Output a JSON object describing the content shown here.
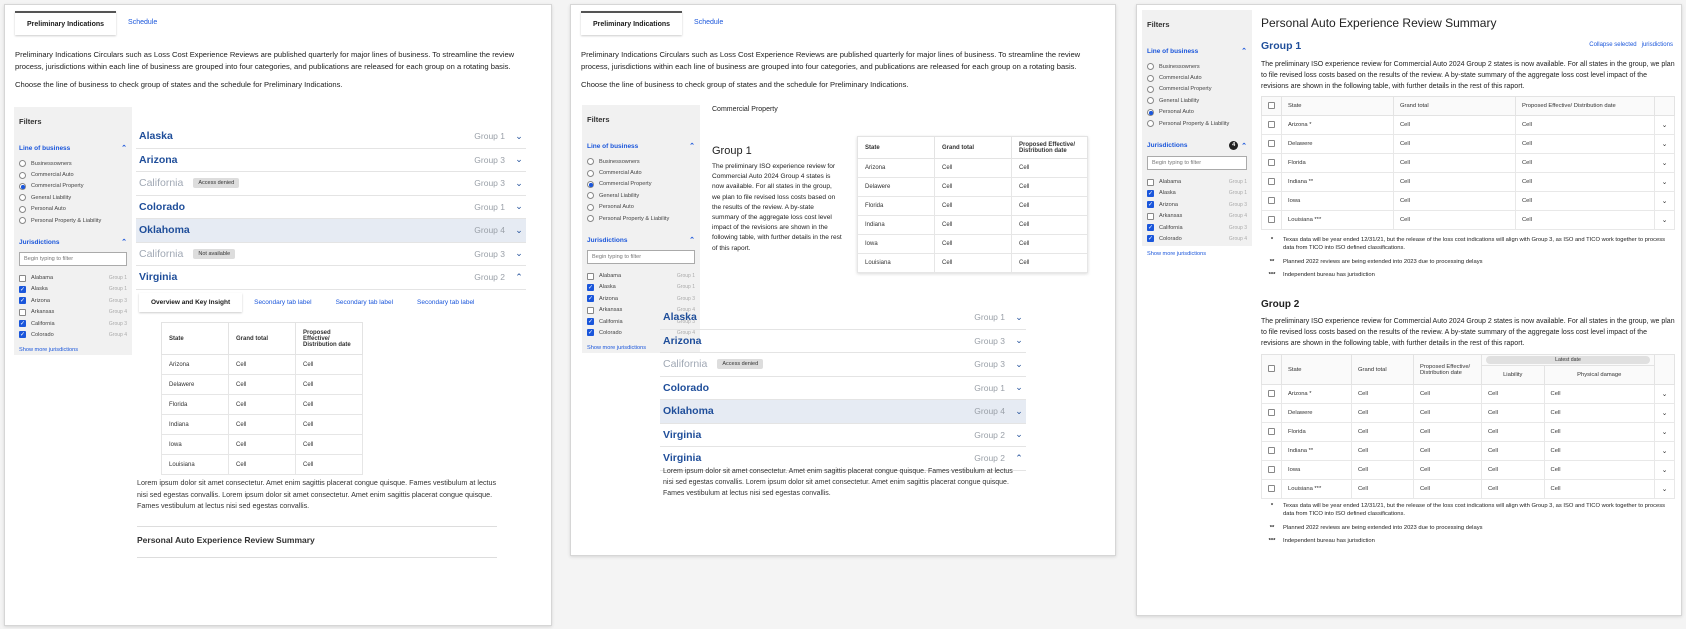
{
  "tabs": [
    "Preliminary Indications",
    "Schedule"
  ],
  "intro": {
    "p1": "Preliminary Indications Circulars such as Loss Cost Experience Reviews are published quarterly for major lines of business. To streamline the review process, jurisdictions within each line of business are grouped into four categories, and publications are released for each group on a rotating basis.",
    "p2": "Choose the line of business to check group of states and the schedule for Preliminary Indications."
  },
  "filters": {
    "title": "Filters",
    "lob_label": "Line of business",
    "lob_items": [
      "Businessowners",
      "Commercial Auto",
      "Commercial Property",
      "General Liability",
      "Personal Auto",
      "Personal Property & Liability"
    ],
    "jur_label": "Jurisdictions",
    "jur_placeholder": "Begin typing to filter",
    "jur_count": "4",
    "jur_items": [
      {
        "name": "Alabama",
        "group": "Group 1"
      },
      {
        "name": "Alaska",
        "group": "Group 1"
      },
      {
        "name": "Arizona",
        "group": "Group 3"
      },
      {
        "name": "Arkansas",
        "group": "Group 4"
      },
      {
        "name": "California",
        "group": "Group 3"
      },
      {
        "name": "Colorado",
        "group": "Group 4"
      }
    ],
    "show_more": "Show more jurisdictions"
  },
  "states": [
    {
      "name": "Alaska",
      "group": "Group 1",
      "badge": ""
    },
    {
      "name": "Arizona",
      "group": "Group 3",
      "badge": ""
    },
    {
      "name": "California",
      "group": "Group 3",
      "badge": "Access denied"
    },
    {
      "name": "Colorado",
      "group": "Group 1",
      "badge": ""
    },
    {
      "name": "Oklahoma",
      "group": "Group 4",
      "badge": ""
    },
    {
      "name": "California",
      "group": "Group 3",
      "badge": "Not available"
    },
    {
      "name": "Virginia",
      "group": "Group 2",
      "badge": ""
    }
  ],
  "subtabs": [
    "Overview and Key Insight",
    "Secondary tab label",
    "Secondary tab label",
    "Secondary tab label"
  ],
  "table": {
    "headers": [
      "State",
      "Grand total",
      "Proposed Effective/ Distribution date"
    ],
    "rows": [
      [
        "Arizona",
        "Cell",
        "Cell"
      ],
      [
        "Delawere",
        "Cell",
        "Cell"
      ],
      [
        "Florida",
        "Cell",
        "Cell"
      ],
      [
        "Indiana",
        "Cell",
        "Cell"
      ],
      [
        "Iowa",
        "Cell",
        "Cell"
      ],
      [
        "Louisiana",
        "Cell",
        "Cell"
      ]
    ]
  },
  "lorem": "Lorem ipsum dolor sit amet consectetur. Amet enim sagittis placerat congue quisque. Fames vestibulum at lectus nisi sed egestas convallis. Lorem ipsum dolor sit amet consectetur. Amet enim sagittis placerat congue quisque. Fames vestibulum at lectus nisi sed egestas convallis.",
  "summary_label": "Personal Auto Experience Review Summary",
  "p2": {
    "lob_caption": "Commercial Property",
    "group_title": "Group 1",
    "group_desc": "The preliminary ISO experience review for Commercial Auto 2024 Group 4 states is now available. For all states in the group, we plan to file revised loss costs based on the results of the review. A by-state summary of the aggregate loss cost level impact of the revisions are shown in the following table, with further details in the rest of this raport.",
    "states": [
      {
        "name": "Alaska",
        "group": "Group 1",
        "badge": ""
      },
      {
        "name": "Arizona",
        "group": "Group 3",
        "badge": ""
      },
      {
        "name": "California",
        "group": "Group 3",
        "badge": "Access denied"
      },
      {
        "name": "Colorado",
        "group": "Group 1",
        "badge": ""
      },
      {
        "name": "Oklahoma",
        "group": "Group 4",
        "badge": ""
      },
      {
        "name": "Virginia",
        "group": "Group 2",
        "badge": ""
      },
      {
        "name": "Virginia",
        "group": "Group 2",
        "badge": ""
      }
    ]
  },
  "p3": {
    "title": "Personal Auto Experience Review Summary",
    "group1": "Group 1",
    "group2": "Group 2",
    "collapse": "Collapse selected",
    "jurisdictions_link": "jurisdictions",
    "desc": "The preliminary ISO experience review for Commercial Auto 2024 Group 2 states is now available. For all states in the group, we plan to file revised loss costs based on the results of the review. A by-state summary of the aggregate loss cost level impact of the revisions are shown in the following table, with further details in the rest of this raport.",
    "t1_headers": [
      "State",
      "Grand total",
      "Proposed Effective/ Distribution date"
    ],
    "t2_headers": [
      "State",
      "Grand total",
      "Proposed Effective/ Distribution date",
      "Latest date",
      "Liability",
      "Physical damage"
    ],
    "rows": [
      "Arizona *",
      "Delawere",
      "Florida",
      "Indiana **",
      "Iowa",
      "Louisiana ***"
    ],
    "cell": "Cell",
    "notes": [
      {
        "mark": "*",
        "text": "Texas data will be year ended 12/31/21, but the release of the loss cost indications will align with Group 3, as ISO and TICO work together to process data from TICO into ISO defined classifications."
      },
      {
        "mark": "**",
        "text": "Planned 2022 reviews are being extended into 2023 due to processing delays"
      },
      {
        "mark": "***",
        "text": "Independent bureau has jurisdiction"
      }
    ]
  }
}
